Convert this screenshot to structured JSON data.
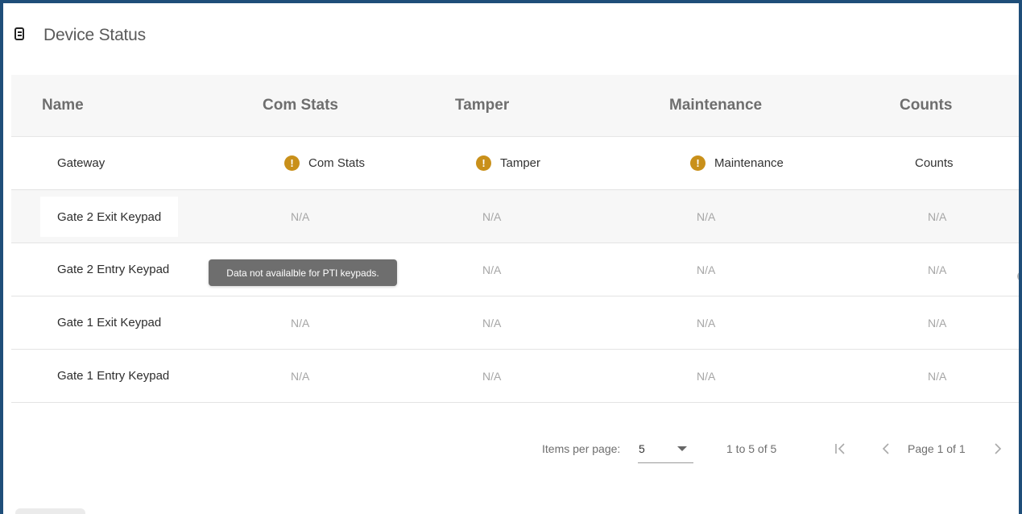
{
  "header": {
    "title": "Device Status",
    "icon": "device-status-icon"
  },
  "columns": [
    "Name",
    "Com Stats",
    "Tamper",
    "Maintenance",
    "Counts"
  ],
  "rows": [
    {
      "name": "Gateway",
      "com": "Com Stats",
      "tamper": "Tamper",
      "maint": "Maintenance",
      "counts": "Counts"
    },
    {
      "name": "Gate 2 Exit Keypad",
      "com": "N/A",
      "tamper": "N/A",
      "maint": "N/A",
      "counts": "N/A"
    },
    {
      "name": "Gate 2 Entry Keypad",
      "com": "N/A",
      "tamper": "N/A",
      "maint": "N/A",
      "counts": "N/A"
    },
    {
      "name": "Gate 1 Exit Keypad",
      "com": "N/A",
      "tamper": "N/A",
      "maint": "N/A",
      "counts": "N/A"
    },
    {
      "name": "Gate 1 Entry Keypad",
      "com": "N/A",
      "tamper": "N/A",
      "maint": "N/A",
      "counts": "N/A"
    }
  ],
  "tooltip": "Data not availalble for PTI keypads.",
  "pager": {
    "items_per_page_label": "Items per page:",
    "items_per_page_value": "5",
    "range": "1 to 5 of 5",
    "page": "Page 1 of 1"
  },
  "colors": {
    "border": "#1f4e79",
    "warning": "#c9901a",
    "tooltip_bg": "#6e6e6e"
  }
}
